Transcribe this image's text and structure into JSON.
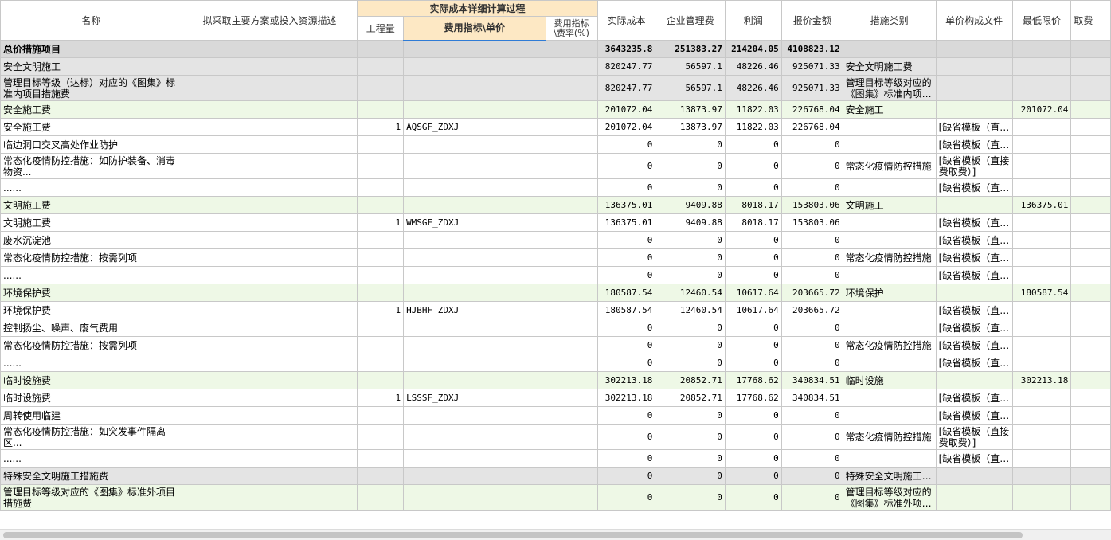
{
  "headers": {
    "name": "名称",
    "plan": "拟采取主要方案或投入资源描述",
    "group": "实际成本详细计算过程",
    "qty": "工程量",
    "fee_index": "费用指标\\单价",
    "fee_rate": "费用指标\\费率(%)",
    "actual_cost": "实际成本",
    "mgmt_fee": "企业管理费",
    "profit": "利润",
    "quote": "报价金额",
    "category": "措施类别",
    "price_file": "单价构成文件",
    "min_price": "最低限价",
    "extra": "取费"
  },
  "rows": [
    {
      "style": "total",
      "name": "总价措施项目",
      "plan": "",
      "qty": "",
      "fee_index": "",
      "fee_rate": "",
      "actual_cost": "3643235.8",
      "mgmt_fee": "251383.27",
      "profit": "214204.05",
      "quote": "4108823.12",
      "category": "",
      "price_file": "",
      "min_price": ""
    },
    {
      "style": "gray",
      "name": "安全文明施工",
      "plan": "",
      "qty": "",
      "fee_index": "",
      "fee_rate": "",
      "actual_cost": "820247.77",
      "mgmt_fee": "56597.1",
      "profit": "48226.46",
      "quote": "925071.33",
      "category": "安全文明施工费",
      "price_file": "",
      "min_price": ""
    },
    {
      "style": "gray",
      "tall": true,
      "name": "管理目标等级（达标）对应的《图集》标准内项目措施费",
      "plan": "",
      "qty": "",
      "fee_index": "",
      "fee_rate": "",
      "actual_cost": "820247.77",
      "mgmt_fee": "56597.1",
      "profit": "48226.46",
      "quote": "925071.33",
      "category": "管理目标等级对应的《图集》标准内项…",
      "price_file": "",
      "min_price": ""
    },
    {
      "style": "green",
      "name": "安全施工费",
      "plan": "",
      "qty": "",
      "fee_index": "",
      "fee_rate": "",
      "actual_cost": "201072.04",
      "mgmt_fee": "13873.97",
      "profit": "11822.03",
      "quote": "226768.04",
      "category": "安全施工",
      "price_file": "",
      "min_price": "201072.04"
    },
    {
      "style": "white",
      "name": "安全施工费",
      "plan": "",
      "qty": "1",
      "fee_index": "AQSGF_ZDXJ",
      "fee_rate": "",
      "actual_cost": "201072.04",
      "mgmt_fee": "13873.97",
      "profit": "11822.03",
      "quote": "226768.04",
      "category": "",
      "price_file": "[缺省模板（直…",
      "min_price": ""
    },
    {
      "style": "white",
      "name": "临边洞口交叉高处作业防护",
      "plan": "",
      "qty": "",
      "fee_index": "",
      "fee_rate": "",
      "actual_cost": "0",
      "mgmt_fee": "0",
      "profit": "0",
      "quote": "0",
      "category": "",
      "price_file": "[缺省模板（直…",
      "min_price": ""
    },
    {
      "style": "white",
      "tall": true,
      "name": "常态化疫情防控措施：如防护装备、消毒物资...",
      "plan": "",
      "qty": "",
      "fee_index": "",
      "fee_rate": "",
      "actual_cost": "0",
      "mgmt_fee": "0",
      "profit": "0",
      "quote": "0",
      "category": "常态化疫情防控措施",
      "price_file": "[缺省模板（直接费取费）]",
      "min_price": ""
    },
    {
      "style": "white",
      "name": "......",
      "plan": "",
      "qty": "",
      "fee_index": "",
      "fee_rate": "",
      "actual_cost": "0",
      "mgmt_fee": "0",
      "profit": "0",
      "quote": "0",
      "category": "",
      "price_file": "[缺省模板（直…",
      "min_price": ""
    },
    {
      "style": "green",
      "name": "文明施工费",
      "plan": "",
      "qty": "",
      "fee_index": "",
      "fee_rate": "",
      "actual_cost": "136375.01",
      "mgmt_fee": "9409.88",
      "profit": "8018.17",
      "quote": "153803.06",
      "category": "文明施工",
      "price_file": "",
      "min_price": "136375.01"
    },
    {
      "style": "white",
      "name": "文明施工费",
      "plan": "",
      "qty": "1",
      "fee_index": "WMSGF_ZDXJ",
      "fee_rate": "",
      "actual_cost": "136375.01",
      "mgmt_fee": "9409.88",
      "profit": "8018.17",
      "quote": "153803.06",
      "category": "",
      "price_file": "[缺省模板（直…",
      "min_price": ""
    },
    {
      "style": "white",
      "name": "废水沉淀池",
      "plan": "",
      "qty": "",
      "fee_index": "",
      "fee_rate": "",
      "actual_cost": "0",
      "mgmt_fee": "0",
      "profit": "0",
      "quote": "0",
      "category": "",
      "price_file": "[缺省模板（直…",
      "min_price": ""
    },
    {
      "style": "white",
      "name": "常态化疫情防控措施：按需列项",
      "plan": "",
      "qty": "",
      "fee_index": "",
      "fee_rate": "",
      "actual_cost": "0",
      "mgmt_fee": "0",
      "profit": "0",
      "quote": "0",
      "category": "常态化疫情防控措施",
      "price_file": "[缺省模板（直…",
      "min_price": ""
    },
    {
      "style": "white",
      "name": "......",
      "plan": "",
      "qty": "",
      "fee_index": "",
      "fee_rate": "",
      "actual_cost": "0",
      "mgmt_fee": "0",
      "profit": "0",
      "quote": "0",
      "category": "",
      "price_file": "[缺省模板（直…",
      "min_price": ""
    },
    {
      "style": "green",
      "name": "环境保护费",
      "plan": "",
      "qty": "",
      "fee_index": "",
      "fee_rate": "",
      "actual_cost": "180587.54",
      "mgmt_fee": "12460.54",
      "profit": "10617.64",
      "quote": "203665.72",
      "category": "环境保护",
      "price_file": "",
      "min_price": "180587.54"
    },
    {
      "style": "white",
      "name": "环境保护费",
      "plan": "",
      "qty": "1",
      "fee_index": "HJBHF_ZDXJ",
      "fee_rate": "",
      "actual_cost": "180587.54",
      "mgmt_fee": "12460.54",
      "profit": "10617.64",
      "quote": "203665.72",
      "category": "",
      "price_file": "[缺省模板（直…",
      "min_price": ""
    },
    {
      "style": "white",
      "name": "控制扬尘、噪声、废气费用",
      "plan": "",
      "qty": "",
      "fee_index": "",
      "fee_rate": "",
      "actual_cost": "0",
      "mgmt_fee": "0",
      "profit": "0",
      "quote": "0",
      "category": "",
      "price_file": "[缺省模板（直…",
      "min_price": ""
    },
    {
      "style": "white",
      "name": "常态化疫情防控措施：按需列项",
      "plan": "",
      "qty": "",
      "fee_index": "",
      "fee_rate": "",
      "actual_cost": "0",
      "mgmt_fee": "0",
      "profit": "0",
      "quote": "0",
      "category": "常态化疫情防控措施",
      "price_file": "[缺省模板（直…",
      "min_price": ""
    },
    {
      "style": "white",
      "name": "......",
      "plan": "",
      "qty": "",
      "fee_index": "",
      "fee_rate": "",
      "actual_cost": "0",
      "mgmt_fee": "0",
      "profit": "0",
      "quote": "0",
      "category": "",
      "price_file": "[缺省模板（直…",
      "min_price": ""
    },
    {
      "style": "green",
      "name": "临时设施费",
      "plan": "",
      "qty": "",
      "fee_index": "",
      "fee_rate": "",
      "actual_cost": "302213.18",
      "mgmt_fee": "20852.71",
      "profit": "17768.62",
      "quote": "340834.51",
      "category": "临时设施",
      "price_file": "",
      "min_price": "302213.18"
    },
    {
      "style": "white",
      "name": "临时设施费",
      "plan": "",
      "qty": "1",
      "fee_index": "LSSSF_ZDXJ",
      "fee_rate": "",
      "actual_cost": "302213.18",
      "mgmt_fee": "20852.71",
      "profit": "17768.62",
      "quote": "340834.51",
      "category": "",
      "price_file": "[缺省模板（直…",
      "min_price": ""
    },
    {
      "style": "white",
      "name": "周转使用临建",
      "plan": "",
      "qty": "",
      "fee_index": "",
      "fee_rate": "",
      "actual_cost": "0",
      "mgmt_fee": "0",
      "profit": "0",
      "quote": "0",
      "category": "",
      "price_file": "[缺省模板（直…",
      "min_price": ""
    },
    {
      "style": "white",
      "tall": true,
      "name": "常态化疫情防控措施：如突发事件隔离区...",
      "plan": "",
      "qty": "",
      "fee_index": "",
      "fee_rate": "",
      "actual_cost": "0",
      "mgmt_fee": "0",
      "profit": "0",
      "quote": "0",
      "category": "常态化疫情防控措施",
      "price_file": "[缺省模板（直接费取费）]",
      "min_price": ""
    },
    {
      "style": "white",
      "name": "......",
      "plan": "",
      "qty": "",
      "fee_index": "",
      "fee_rate": "",
      "actual_cost": "0",
      "mgmt_fee": "0",
      "profit": "0",
      "quote": "0",
      "category": "",
      "price_file": "[缺省模板（直…",
      "min_price": ""
    },
    {
      "style": "gray",
      "name": "特殊安全文明施工措施费",
      "plan": "",
      "qty": "",
      "fee_index": "",
      "fee_rate": "",
      "actual_cost": "0",
      "mgmt_fee": "0",
      "profit": "0",
      "quote": "0",
      "category": "特殊安全文明施工…",
      "price_file": "",
      "min_price": ""
    },
    {
      "style": "green",
      "tall": true,
      "name": "管理目标等级对应的《图集》标准外项目措施费",
      "plan": "",
      "qty": "",
      "fee_index": "",
      "fee_rate": "",
      "actual_cost": "0",
      "mgmt_fee": "0",
      "profit": "0",
      "quote": "0",
      "category": "管理目标等级对应的《图集》标准外项…",
      "price_file": "",
      "min_price": ""
    }
  ]
}
